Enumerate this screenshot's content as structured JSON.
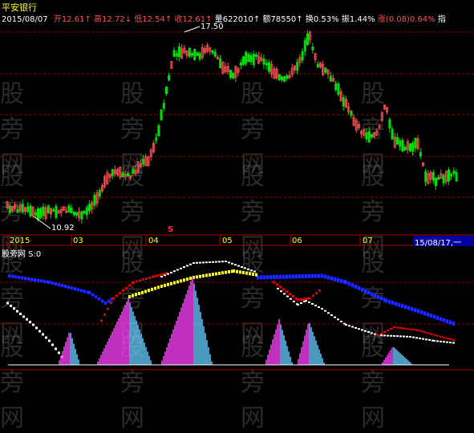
{
  "watermark": "股旁网",
  "top_panel": {
    "symbol": "平安银行",
    "date": "2015/08/07",
    "open_label": "开",
    "open_value": "12.61",
    "high_label": "高",
    "high_value": "12.72",
    "low_label": "低",
    "low_value": "12.54",
    "close_label": "收",
    "close_value": "12.61",
    "volume_label": "量",
    "volume_value": "622010",
    "amount_label": "额",
    "amount_value": "78550",
    "turnover_label": "换",
    "turnover_value": "0.53%",
    "amplitude_label": "振",
    "amplitude_value": "1.44%",
    "change_label": "涨",
    "change_value": "(0.08)0.64%",
    "indicator_label": "指",
    "max_annotation": "17.50",
    "min_annotation": "10.92",
    "s_marker": "S"
  },
  "time_axis": {
    "labels": [
      "2015",
      "03",
      "04",
      "05",
      "06",
      "07"
    ],
    "cursor_date": "15/08/17,",
    "cursor_extra": "一"
  },
  "bottom_panel": {
    "title": "股旁网 S:0"
  },
  "colors": {
    "up": "#ff5050",
    "down": "#00e000",
    "grid": "#8b0000",
    "axis": "#b00000",
    "label_white": "#ffffff",
    "symbol_yellow": "#ffff00",
    "blue_line": "#1c2cff",
    "red_line": "#e00000",
    "yellow_line": "#ffff40",
    "white_line": "#ffffff",
    "magenta": "#ff40ff",
    "cyan": "#66ccff"
  }
}
